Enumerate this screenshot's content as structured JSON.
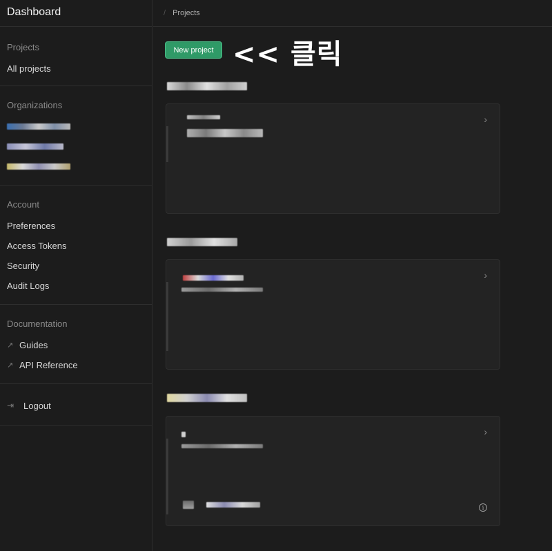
{
  "app": {
    "title": "Dashboard"
  },
  "breadcrumb": {
    "separator": "/",
    "current": "Projects"
  },
  "sidebar": {
    "projects": {
      "heading": "Projects",
      "items": [
        {
          "label": "All projects"
        }
      ]
    },
    "organizations": {
      "heading": "Organizations"
    },
    "account": {
      "heading": "Account",
      "items": [
        {
          "label": "Preferences"
        },
        {
          "label": "Access Tokens"
        },
        {
          "label": "Security"
        },
        {
          "label": "Audit Logs"
        }
      ]
    },
    "documentation": {
      "heading": "Documentation",
      "items": [
        {
          "label": "Guides",
          "icon": "external-link-icon"
        },
        {
          "label": "API Reference",
          "icon": "external-link-icon"
        }
      ]
    },
    "logout": {
      "label": "Logout",
      "icon": "logout-icon"
    }
  },
  "main": {
    "new_project_label": "New project",
    "annotation": "<< 클릭",
    "chevron_glyph": "›",
    "info_glyph": "i"
  },
  "colors": {
    "accent": "#2f9a67",
    "background": "#1c1c1c",
    "card": "#232323"
  }
}
